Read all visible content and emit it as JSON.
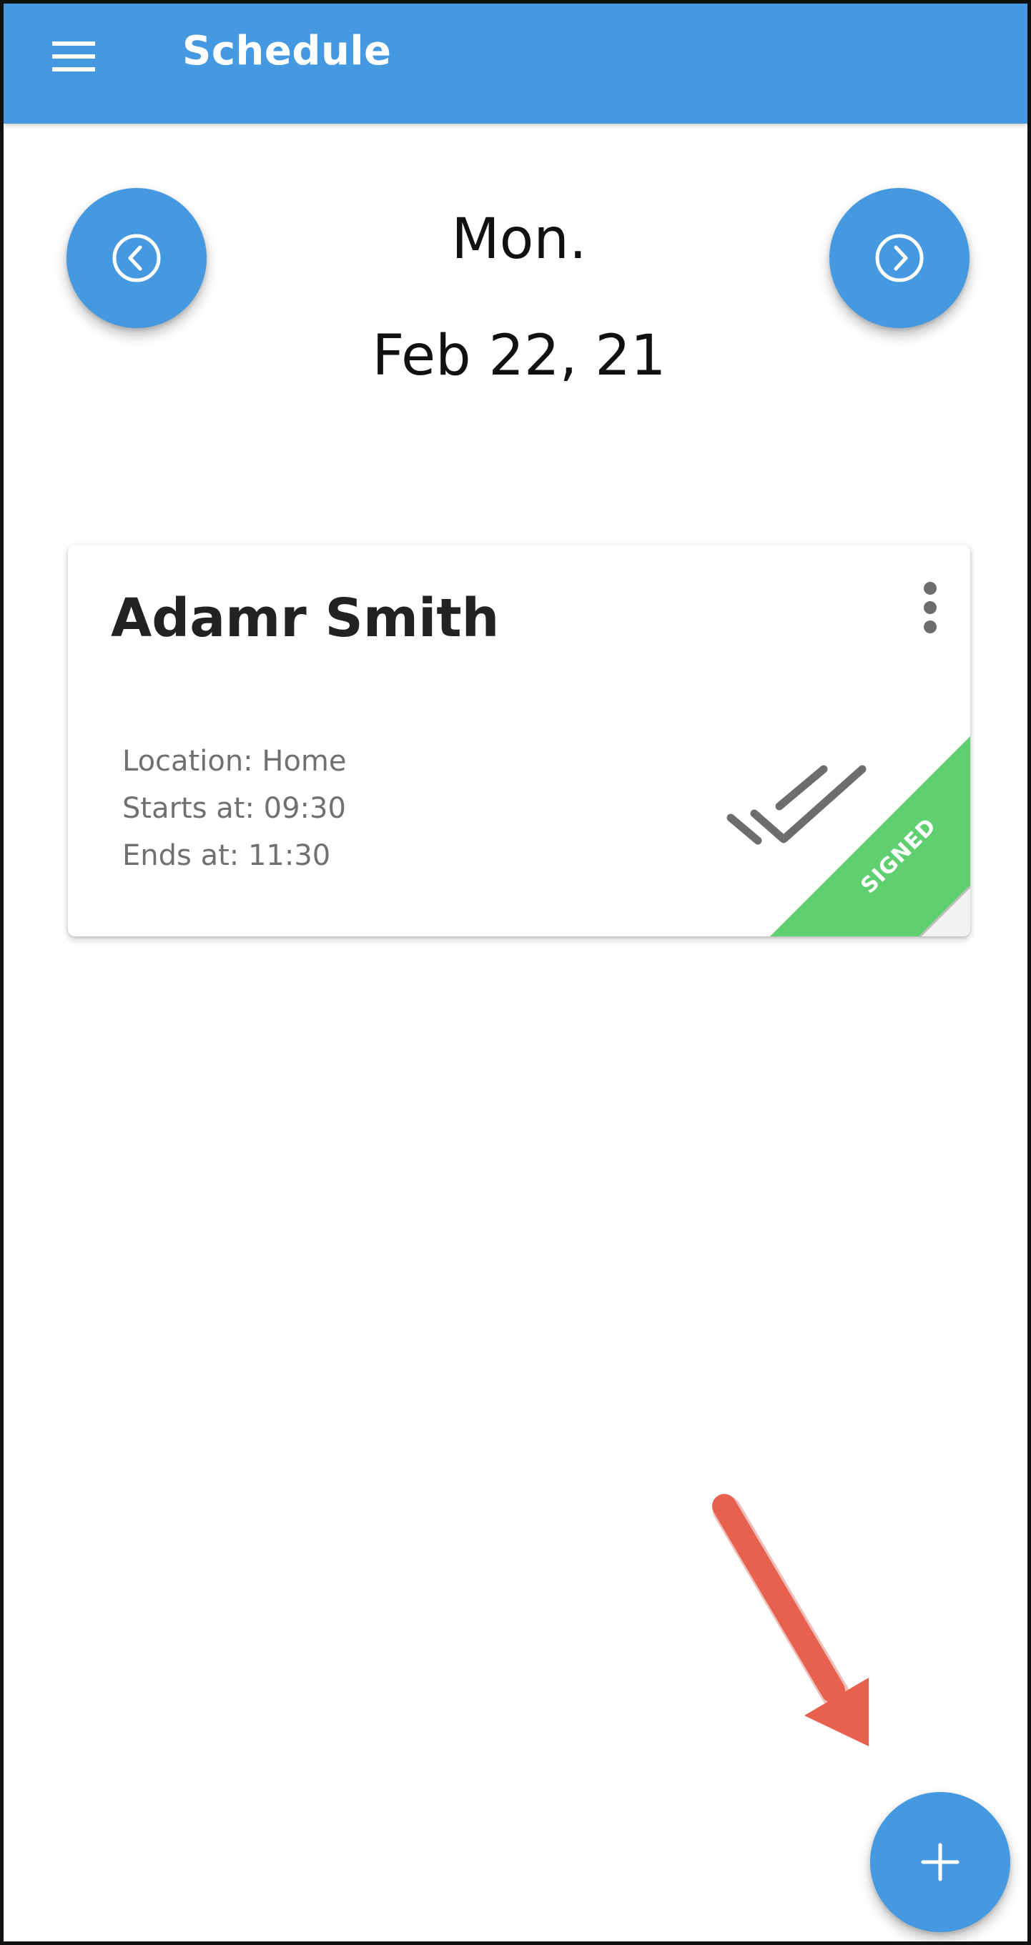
{
  "appbar": {
    "title": "Schedule",
    "menu_icon": "hamburger-menu-icon",
    "color": "#4499e0"
  },
  "date_nav": {
    "day": "Mon.",
    "date": "Feb 22, 21",
    "prev_icon": "chevron-left-circle-icon",
    "next_icon": "chevron-right-circle-icon"
  },
  "appointment": {
    "name": "Adamr Smith",
    "location": "Location: Home",
    "starts": "Starts at: 09:30",
    "ends": "Ends at: 11:30",
    "status": "SIGNED",
    "status_color": "#5fcf6f",
    "menu_icon": "more-vertical-icon",
    "check_icon": "double-check-icon"
  },
  "fab": {
    "icon": "plus-icon"
  },
  "annotation": {
    "arrow_color": "#e8604e"
  }
}
